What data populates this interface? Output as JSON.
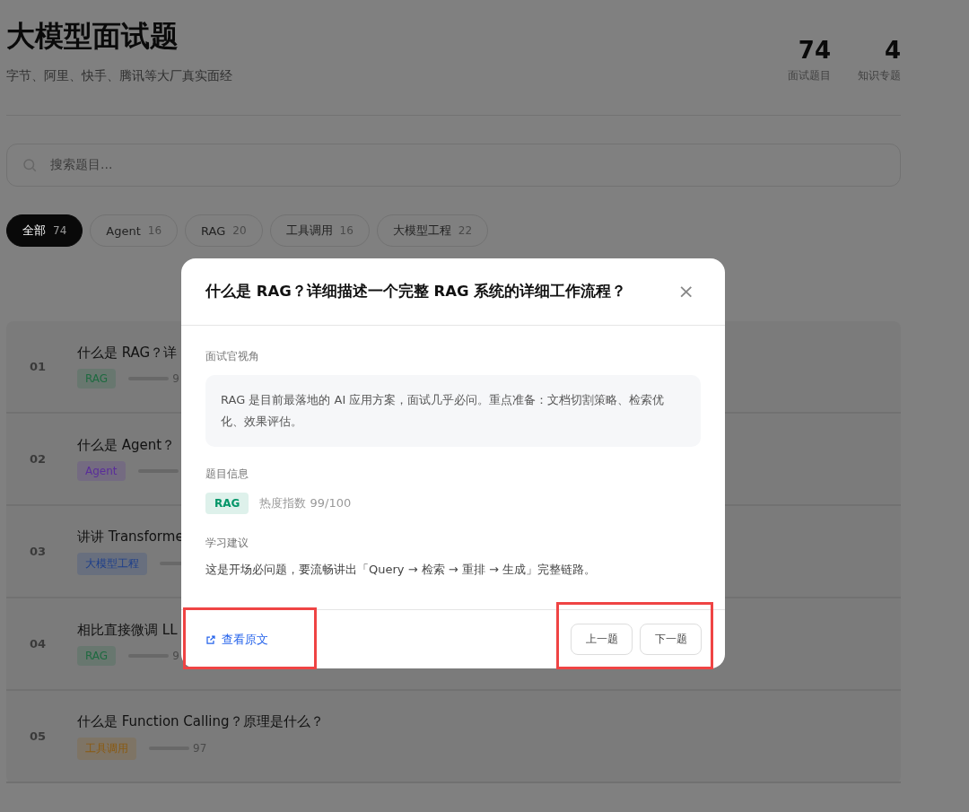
{
  "header": {
    "title": "大模型面试题",
    "subtitle": "字节、阿里、快手、腾讯等大厂真实面经"
  },
  "stats": [
    {
      "value": "74",
      "label": "面试题目"
    },
    {
      "value": "4",
      "label": "知识专题"
    }
  ],
  "search": {
    "placeholder": "搜索题目..."
  },
  "filters": [
    {
      "label": "全部",
      "count": "74",
      "selected": true
    },
    {
      "label": "Agent",
      "count": "16",
      "selected": false
    },
    {
      "label": "RAG",
      "count": "20",
      "selected": false
    },
    {
      "label": "工具调用",
      "count": "16",
      "selected": false
    },
    {
      "label": "大模型工程",
      "count": "22",
      "selected": false
    }
  ],
  "questions": [
    {
      "number": "01",
      "title": "什么是 RAG？详",
      "tag": "RAG",
      "color": "#1e6a40",
      "score": "9"
    },
    {
      "number": "02",
      "title": "什么是 Agent？",
      "tag": "Agent",
      "color": "#5a2d9a"
    },
    {
      "number": "03",
      "title": "讲讲 Transforme",
      "tag": "大模型工程",
      "color": "#1e3f8a"
    },
    {
      "number": "04",
      "title": "相比直接微调 LL",
      "tag": "RAG",
      "color": "#1e6a40",
      "score": "9"
    },
    {
      "number": "05",
      "title": "什么是 Function Calling？原理是什么？",
      "tag": "工具调用",
      "color": "#8a5a10",
      "score": "97"
    }
  ],
  "dialog": {
    "title": "什么是 RAG？详细描述一个完整 RAG 系统的详细工作流程？",
    "close": "×",
    "sections": [
      {
        "kind": "callout",
        "heading": "面试官视角",
        "text": "RAG 是目前最落地的 AI 应用方案，面试几乎必问。重点准备：文档切割策略、检索优化、效果评估。"
      },
      {
        "kind": "info",
        "heading": "题目信息",
        "tag": "RAG",
        "color": "#059669",
        "text": "热度指数 99/100"
      },
      {
        "kind": "text",
        "heading": "学习建议",
        "text": "这是开场必问题，要流畅讲出「Query → 检索 → 重排 → 生成」完整链路。"
      }
    ],
    "link": {
      "label": "查看原文",
      "highlighted": true
    },
    "buttons": [
      "上一题",
      "下一题"
    ],
    "buttons_highlighted": true
  }
}
